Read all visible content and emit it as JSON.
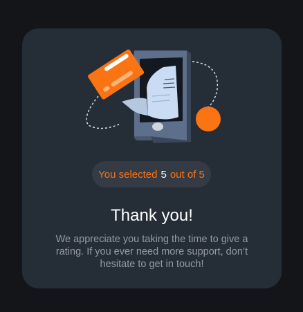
{
  "rating": {
    "prefix": "You selected",
    "value": "5",
    "suffix": "out of 5"
  },
  "title": "Thank you!",
  "description": "We appreciate you taking the time to give a rating. If you ever need more support, don’t hesitate to get in touch!",
  "colors": {
    "background": "#131518",
    "card": "#252d37",
    "pill": "#343b45",
    "accent": "#fb7413",
    "text_muted": "#949ba6"
  },
  "icons": [
    "credit-card-icon",
    "phone-icon",
    "receipt-icon",
    "orange-circle-icon"
  ]
}
